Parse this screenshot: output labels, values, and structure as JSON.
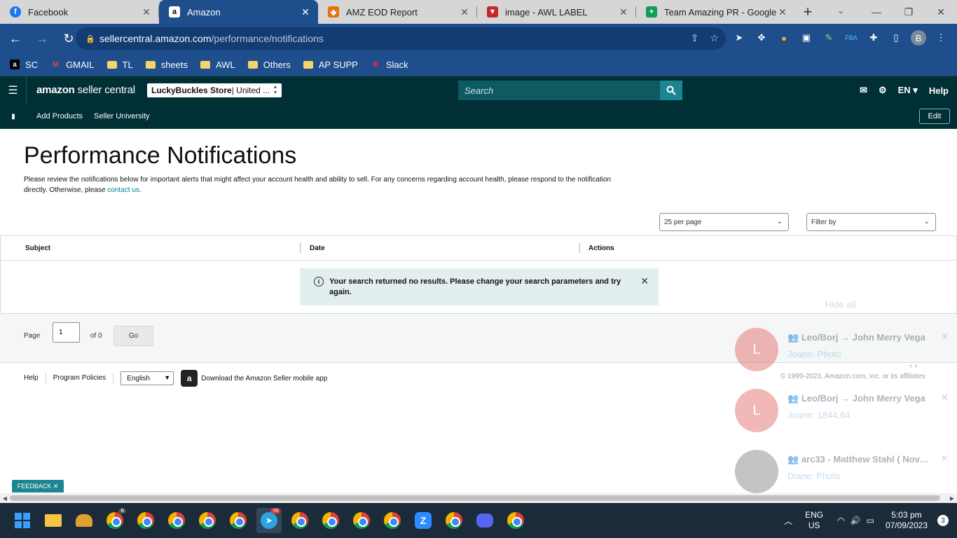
{
  "browser": {
    "tabs": [
      {
        "title": "Facebook",
        "icon": "facebook-icon",
        "color": "#1877f2",
        "glyph": "f"
      },
      {
        "title": "Amazon",
        "icon": "amazon-icon",
        "color": "#000000",
        "glyph": "a"
      },
      {
        "title": "AMZ EOD Report",
        "icon": "report-icon",
        "color": "#e8710a",
        "glyph": "◆"
      },
      {
        "title": "image - AWL LABEL",
        "icon": "label-icon",
        "color": "#c62828",
        "glyph": "▼"
      },
      {
        "title": "Team Amazing PR - Google S",
        "icon": "sheets-icon",
        "color": "#0f9d58",
        "glyph": "+"
      }
    ],
    "url_host": "sellercentral.amazon.com",
    "url_path": "/performance/notifications",
    "profile_initial": "B",
    "bookmarks": [
      {
        "label": "SC",
        "icon": "amazon-icon"
      },
      {
        "label": "GMAIL",
        "icon": "gmail-icon"
      },
      {
        "label": "TL",
        "icon": "folder-icon"
      },
      {
        "label": "sheets",
        "icon": "folder-icon"
      },
      {
        "label": "AWL",
        "icon": "folder-icon"
      },
      {
        "label": "Others",
        "icon": "folder-icon"
      },
      {
        "label": "AP SUPP",
        "icon": "folder-icon"
      },
      {
        "label": "Slack",
        "icon": "slack-icon"
      }
    ]
  },
  "seller": {
    "logo_bold": "amazon",
    "logo_light": " seller central",
    "store_name": "LuckyBuckles Store",
    "store_market": " | United ...",
    "search_placeholder": "Search",
    "language": "EN",
    "help": "Help",
    "subnav": [
      "Add Products",
      "Seller University"
    ],
    "edit": "Edit"
  },
  "page": {
    "title": "Performance Notifications",
    "intro": "Please review the notifications below for important alerts that might affect your account health and ability to sell. For any concerns regarding account health, please respond to the notification directly. Otherwise, please ",
    "intro_link": "contact us",
    "intro_end": ".",
    "per_page": "25 per page",
    "filter": "Filter by",
    "columns": [
      "Subject",
      "Date",
      "Actions"
    ],
    "alert": "Your search returned no results. Please change your search parameters and try again.",
    "pager": {
      "page_label": "Page",
      "page_value": "1",
      "of_label": "of 0",
      "go": "Go"
    }
  },
  "footer": {
    "links": [
      "Help",
      "Program Policies"
    ],
    "language": "English",
    "app_text": "Download the Amazon Seller mobile app",
    "copyright": "© 1999-2023, Amazon.com, Inc. or its affiliates"
  },
  "notifications": {
    "hide_all": "Hide all",
    "items": [
      {
        "title": "Leo/Borj → John Merry Vega",
        "sender": "Joann:",
        "body": "Photo",
        "avatar": "L",
        "color": "#e57373"
      },
      {
        "title": "Leo/Borj → John Merry Vega",
        "sender": "Joann:",
        "body": "1844.64",
        "avatar": "L",
        "color": "#e57373"
      },
      {
        "title": "arc33 - Matthew Stahl ( Nov…",
        "sender": "Diane:",
        "body": "Photo",
        "avatar": "",
        "color": "#8a8a8a"
      }
    ]
  },
  "feedback": "FEEDBACK",
  "taskbar": {
    "lang_top": "ENG",
    "lang_bottom": "US",
    "time": "5:03 pm",
    "date": "07/09/2023",
    "notification_count": "3",
    "telegram_badge": "78"
  }
}
